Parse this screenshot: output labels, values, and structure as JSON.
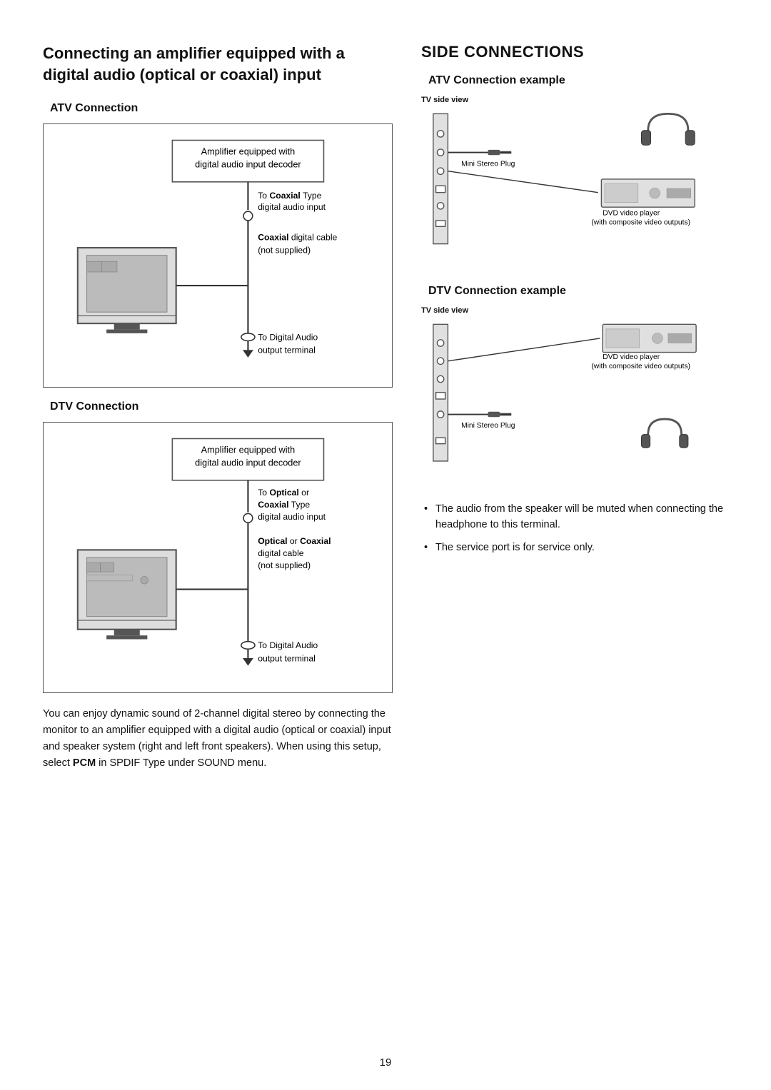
{
  "page": {
    "number": "19"
  },
  "left": {
    "main_title": "Connecting an amplifier equipped with a digital audio (optical or coaxial) input",
    "atv_connection": {
      "heading": "ATV Connection",
      "amplifier_label": "Amplifier equipped with\ndigital audio input decoder",
      "coaxial_label": "To Coaxial Type\ndigital audio input",
      "cable_label_bold": "Coaxial",
      "cable_label_rest": " digital cable\n(not supplied)",
      "output_label": "To Digital Audio\noutput terminal"
    },
    "dtv_connection": {
      "heading": "DTV Connection",
      "amplifier_label": "Amplifier equipped with\ndigital audio input decoder",
      "optical_label_pre": "To ",
      "optical_label_bold1": "Optical",
      "optical_label_mid": " or\n",
      "optical_label_bold2": "Coaxial",
      "optical_label_rest": " Type\ndigital audio input",
      "cable_label_bold1": "Optical",
      "cable_label_mid": " or ",
      "cable_label_bold2": "Coaxial",
      "cable_label_rest": "\ndigital cable\n(not supplied)",
      "output_label": "To Digital Audio\noutput terminal"
    },
    "bottom_text": "You can enjoy dynamic sound of 2-channel digital stereo by connecting the monitor to an amplifier equipped with a digital audio (optical or coaxial) input and speaker system (right and left front speakers). When using this setup, select ",
    "bottom_text_bold": "PCM",
    "bottom_text_end": " in SPDIF Type under SOUND menu."
  },
  "right": {
    "section_title": "SIDE CONNECTIONS",
    "atv_example": {
      "heading": "ATV Connection example",
      "tv_side_label": "TV side view",
      "mini_stereo_label": "Mini Stereo Plug",
      "dvd_label": "DVD video player\n(with composite video outputs)"
    },
    "dtv_example": {
      "heading": "DTV Connection example",
      "tv_side_label": "TV side view",
      "dvd_label": "DVD video player\n(with composite video outputs)",
      "mini_stereo_label": "Mini Stereo Plug"
    },
    "bullets": [
      "The audio from the speaker will be muted when connecting the headphone to this terminal.",
      "The service port is for service only."
    ]
  }
}
